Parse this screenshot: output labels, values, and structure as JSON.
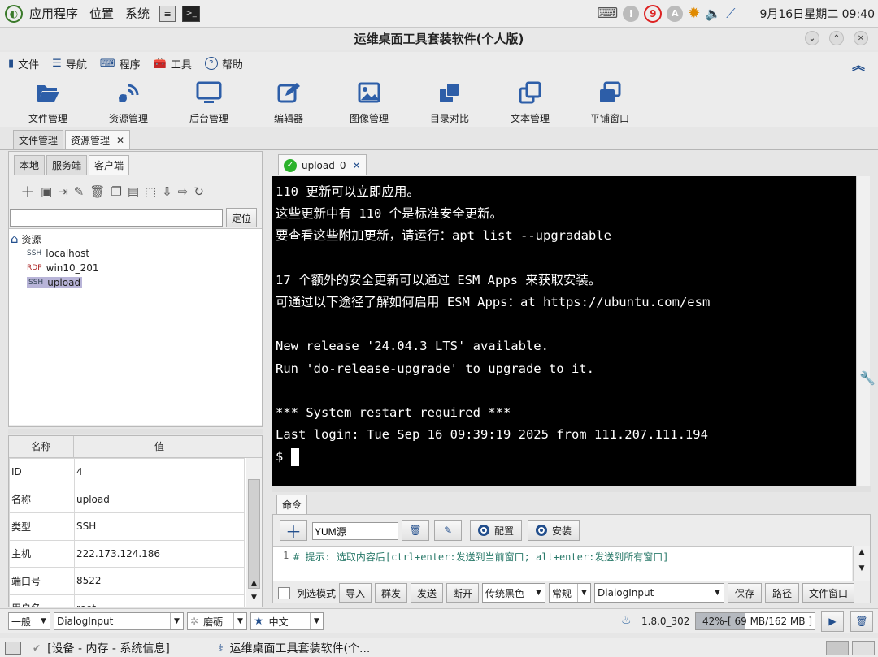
{
  "topbar": {
    "menus": [
      "应用程序",
      "位置",
      "系统"
    ],
    "notif_count": "9",
    "notif_a": "A",
    "clock": "9月16日星期二 09:40"
  },
  "window": {
    "title": "运维桌面工具套装软件(个人版)"
  },
  "menubar": [
    {
      "label": "文件",
      "icon": "file-icon"
    },
    {
      "label": "导航",
      "icon": "list-icon"
    },
    {
      "label": "程序",
      "icon": "keyboard-icon"
    },
    {
      "label": "工具",
      "icon": "toolbox-icon"
    },
    {
      "label": "帮助",
      "icon": "help-icon"
    }
  ],
  "toolbar": [
    {
      "label": "文件管理",
      "icon": "folder-open-icon"
    },
    {
      "label": "资源管理",
      "icon": "satellite-icon"
    },
    {
      "label": "后台管理",
      "icon": "monitor-icon"
    },
    {
      "label": "编辑器",
      "icon": "edit-icon"
    },
    {
      "label": "图像管理",
      "icon": "image-icon"
    },
    {
      "label": "目录对比",
      "icon": "clone-icon"
    },
    {
      "label": "文本管理",
      "icon": "copy-icon"
    },
    {
      "label": "平铺窗口",
      "icon": "windows-icon"
    }
  ],
  "main_tabs": [
    {
      "label": "文件管理"
    },
    {
      "label": "资源管理"
    }
  ],
  "side_tabs": [
    "本地",
    "服务端",
    "客户端"
  ],
  "locate_label": "定位",
  "tree": {
    "root": "资源",
    "items": [
      {
        "proto": "SSH",
        "name": "localhost"
      },
      {
        "proto": "RDP",
        "name": "win10_201"
      },
      {
        "proto": "SSH",
        "name": "upload"
      }
    ]
  },
  "props": {
    "headers": [
      "名称",
      "值"
    ],
    "rows": [
      {
        "k": "ID",
        "v": "4"
      },
      {
        "k": "名称",
        "v": "upload"
      },
      {
        "k": "类型",
        "v": "SSH"
      },
      {
        "k": "主机",
        "v": "222.173.124.186"
      },
      {
        "k": "端口号",
        "v": "8522"
      },
      {
        "k": "用户名",
        "v": "root"
      }
    ]
  },
  "session_tab": {
    "label": "upload_0"
  },
  "terminal": {
    "lines": [
      "110 更新可以立即应用。",
      "这些更新中有 110 个是标准安全更新。",
      "要查看这些附加更新，请运行：apt list --upgradable",
      "",
      "17 个额外的安全更新可以通过 ESM Apps 来获取安装。",
      "可通过以下途径了解如何启用 ESM Apps：at https://ubuntu.com/esm",
      "",
      "New release '24.04.3 LTS' available.",
      "Run 'do-release-upgrade' to upgrade to it.",
      "",
      "*** System restart required ***",
      "Last login: Tue Sep 16 09:39:19 2025 from 111.207.111.194"
    ],
    "prompt": "$"
  },
  "cmd": {
    "tab": "命令",
    "input": "YUM源",
    "config": "配置",
    "install": "安装",
    "line_no": "1",
    "hint": "# 提示: 选取内容后[ctrl+enter:发送到当前窗口; alt+enter:发送到所有窗口]"
  },
  "cmd_bottom": {
    "col_mode": "列选模式",
    "import": "导入",
    "group": "群发",
    "send": "发送",
    "disconnect": "断开",
    "theme": "传统黑色",
    "style": "常规",
    "font": "DialogInput",
    "save": "保存",
    "path": "路径",
    "file_win": "文件窗口"
  },
  "statusbar": {
    "mode": "一般",
    "font": "DialogInput",
    "skin": "磨砺",
    "lang": "中文",
    "version": "1.8.0_302",
    "memory": "42%-[ 69 MB/162 MB ]"
  },
  "taskbar": {
    "item1": "[设备 - 内存 - 系统信息]",
    "item2": "运维桌面工具套装软件(个..."
  }
}
